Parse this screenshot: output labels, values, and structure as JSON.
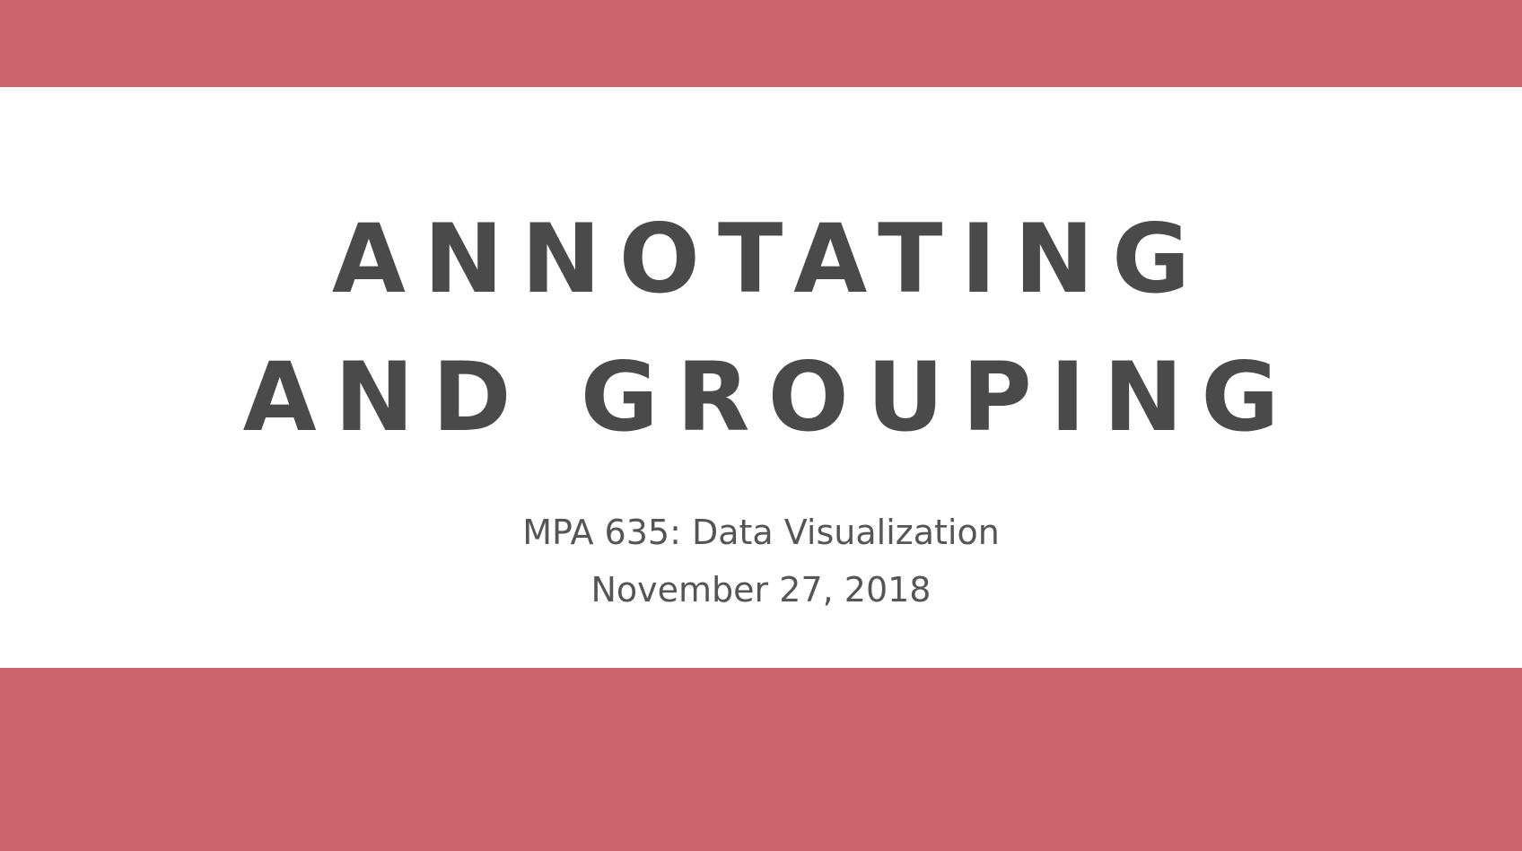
{
  "slide": {
    "title_line1": "ANNOTATING",
    "title_line2": "AND GROUPING",
    "course": "MPA 635: Data Visualization",
    "date": "November 27, 2018"
  },
  "colors": {
    "band": "#CB636B",
    "text": "#4A4A4A",
    "subtext": "#555555",
    "background": "#FFFFFF"
  }
}
